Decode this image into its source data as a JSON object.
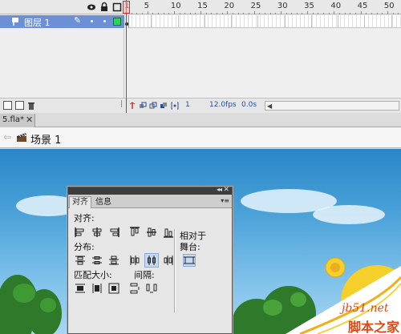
{
  "timeline": {
    "ruler_numbers": [
      "1",
      "5",
      "10",
      "15",
      "20",
      "25",
      "30",
      "35",
      "40",
      "45",
      "50"
    ],
    "header_icons": [
      "eye-icon",
      "lock-icon",
      "outline-icon"
    ],
    "layer": {
      "name": "图层 1",
      "color": "#2bd35c"
    },
    "footer": {
      "current_frame": "1",
      "frame_rate": "12.0fps",
      "elapsed_time": "0.0s"
    }
  },
  "document": {
    "tab_label": "5.fla*",
    "close_label": "✕"
  },
  "edit_bar": {
    "scene_label": "场景 1"
  },
  "align_panel": {
    "tabs": [
      "对齐",
      "信息"
    ],
    "align_label": "对齐:",
    "distribute_label": "分布:",
    "match_size_label": "匹配大小:",
    "spacing_label": "间隔:",
    "relative_label_line1": "相对于",
    "relative_label_line2": "舞台:"
  },
  "watermark": {
    "url": "jb51.net",
    "name": "脚本之家"
  },
  "colors": {
    "layer_selected": "#6d8fd3",
    "playhead": "#d0302a",
    "stage_sky": "#4aa2d8",
    "watermark": "#e04a12"
  }
}
